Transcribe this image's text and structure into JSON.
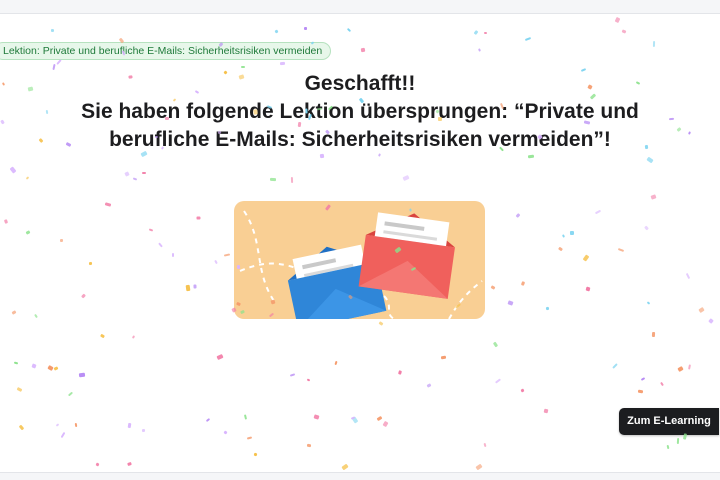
{
  "lesson_chip": {
    "label": "Lektion: Private und berufliche E-Mails: Sicherheitsrisiken vermeiden"
  },
  "headline": {
    "line1": "Geschafft!!",
    "line2": "Sie haben folgende Lektion übersprungen: “Private und",
    "line3": "berufliche E-Mails: Sicherheitsrisiken vermeiden”!"
  },
  "illustration": {
    "icon": "envelopes-illustration"
  },
  "cta": {
    "label": "Zum E-Learning"
  },
  "confetti": {
    "colors": [
      "#f27ba6",
      "#7ad3f0",
      "#b88cf5",
      "#f6c14b",
      "#8be28b",
      "#f59a6b",
      "#d8b4fe"
    ]
  },
  "theme": {
    "chip_bg": "#e7f7ea",
    "chip_text": "#1f7a3a",
    "illustration_bg": "#f9cf94",
    "envelope_blue": "#2f86d8",
    "envelope_red": "#f0605c",
    "button_bg": "#1c1d20"
  }
}
